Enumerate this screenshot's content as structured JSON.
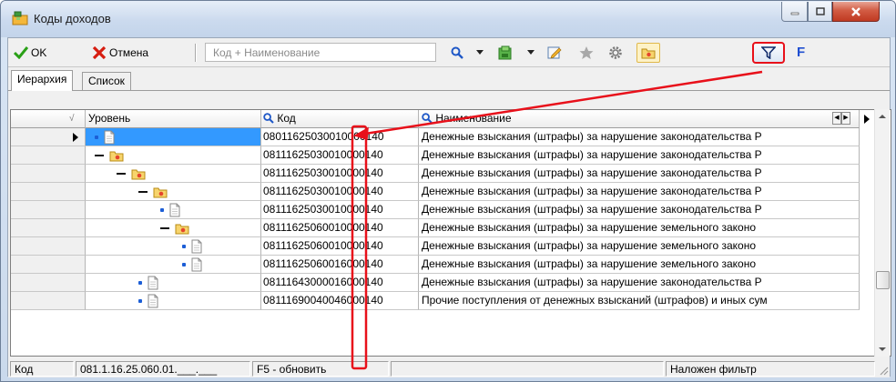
{
  "window": {
    "title": "Коды доходов",
    "minimize_glyph": "–",
    "maximize_glyph": "□",
    "close_glyph": "X"
  },
  "toolbar": {
    "ok_label": "OK",
    "cancel_label": "Отмена",
    "search_placeholder": "Код + Наименование",
    "filter_letter": "F",
    "icons": [
      "search-icon",
      "export-icon",
      "edit-icon",
      "star-icon",
      "settings-icon",
      "folder-icon",
      "filter-icon"
    ]
  },
  "tabs": [
    {
      "label": "Иерархия",
      "active": true
    },
    {
      "label": "Список",
      "active": false
    }
  ],
  "grid": {
    "headers": {
      "level": "Уровень",
      "code": "Код",
      "name": "Наименование"
    },
    "rows": [
      {
        "depth": 0,
        "kind": "doc",
        "code": "08011625030010000140",
        "name": "Денежные взыскания (штрафы) за нарушение законодательства Р",
        "selected": true
      },
      {
        "depth": 0,
        "kind": "folder",
        "code": "08111625030010000140",
        "name": "Денежные взыскания (штрафы) за нарушение законодательства Р",
        "selected": false
      },
      {
        "depth": 1,
        "kind": "folder",
        "code": "08111625030010000140",
        "name": "Денежные взыскания (штрафы) за нарушение законодательства Р",
        "selected": false
      },
      {
        "depth": 2,
        "kind": "folder",
        "code": "08111625030010000140",
        "name": "Денежные взыскания (штрафы) за нарушение законодательства Р",
        "selected": false
      },
      {
        "depth": 3,
        "kind": "doc",
        "code": "08111625030010000140",
        "name": "Денежные взыскания (штрафы) за нарушение законодательства Р",
        "selected": false
      },
      {
        "depth": 3,
        "kind": "folder",
        "code": "08111625060010000140",
        "name": "Денежные взыскания (штрафы) за нарушение земельного законо",
        "selected": false
      },
      {
        "depth": 4,
        "kind": "doc",
        "code": "08111625060010000140",
        "name": "Денежные взыскания (штрафы) за нарушение земельного законо",
        "selected": false
      },
      {
        "depth": 4,
        "kind": "doc",
        "code": "08111625060016000140",
        "name": "Денежные взыскания (штрафы) за нарушение земельного законо",
        "selected": false
      },
      {
        "depth": 2,
        "kind": "doc",
        "code": "08111643000016000140",
        "name": "Денежные взыскания (штрафы) за нарушение законодательства Р",
        "selected": false
      },
      {
        "depth": 2,
        "kind": "doc",
        "code": "08111690040046000140",
        "name": "Прочие поступления от денежных взысканий (штрафов) и иных сум",
        "selected": false
      }
    ]
  },
  "status": {
    "field_label": "Код",
    "code_mask": "081.1.16.25.060.01.___.___",
    "refresh_hint": "F5 - обновить",
    "empty": "",
    "filter_state": "Наложен фильтр"
  },
  "colors": {
    "selection": "#3399ff",
    "annotation_red": "#e8101a",
    "tree_blue": "#1c5ed6"
  }
}
